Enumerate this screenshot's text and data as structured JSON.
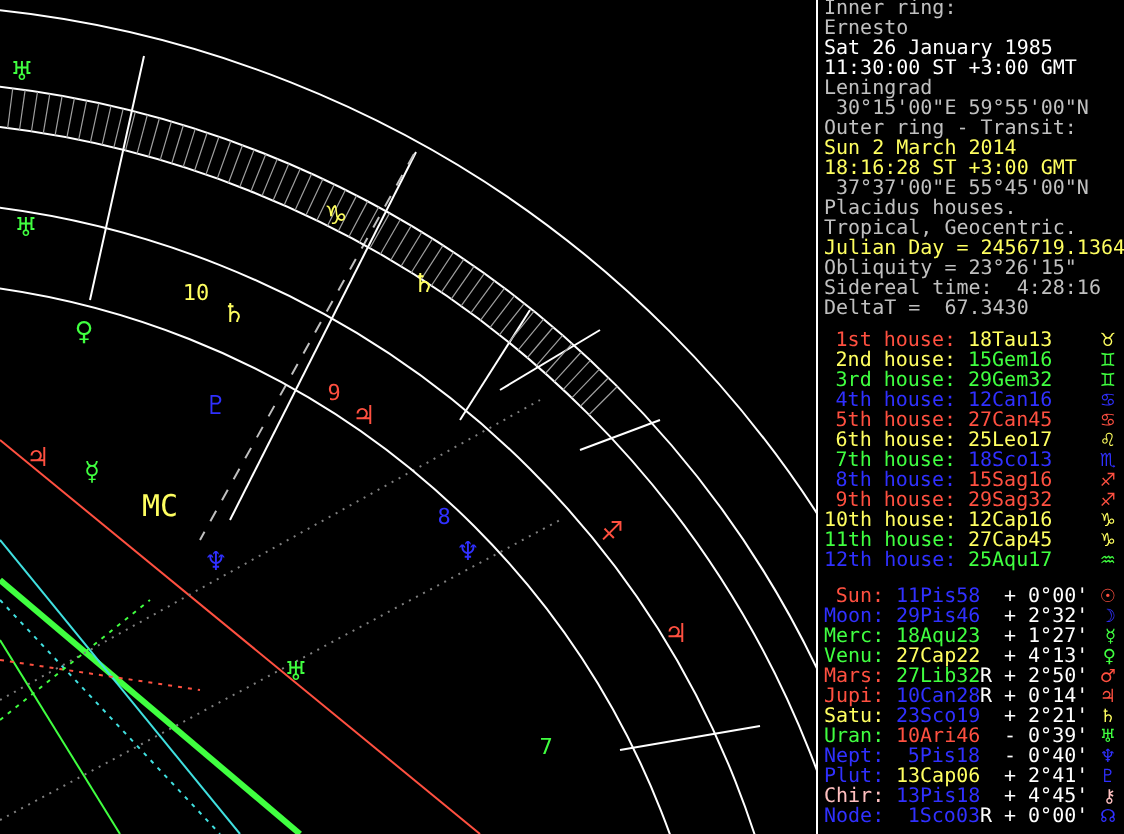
{
  "chart": {
    "labels": [
      {
        "kind": "planet",
        "text": "♅",
        "color": "#40ff40"
      },
      {
        "kind": "planet",
        "text": "♅",
        "color": "#40ff40"
      },
      {
        "kind": "sign",
        "text": "♑",
        "color": "#ffff60"
      },
      {
        "kind": "planet",
        "text": "♄",
        "color": "#ffff60"
      },
      {
        "kind": "house",
        "text": "10",
        "color": "#ffff60"
      },
      {
        "kind": "planet",
        "text": "♄",
        "color": "#ffff60"
      },
      {
        "kind": "planet",
        "text": "♀",
        "color": "#40ff40"
      },
      {
        "kind": "house",
        "text": "9",
        "color": "#ff5040"
      },
      {
        "kind": "planet",
        "text": "♇",
        "color": "#3030ff"
      },
      {
        "kind": "planet",
        "text": "♃",
        "color": "#ff5040"
      },
      {
        "kind": "planet",
        "text": "♃",
        "color": "#ff5040"
      },
      {
        "kind": "planet",
        "text": "☿",
        "color": "#40ff40"
      },
      {
        "kind": "angle",
        "text": "MC",
        "color": "#ffff60"
      },
      {
        "kind": "planet",
        "text": "♆",
        "color": "#3030ff"
      },
      {
        "kind": "house",
        "text": "8",
        "color": "#3030ff"
      },
      {
        "kind": "planet",
        "text": "♆",
        "color": "#3030ff"
      },
      {
        "kind": "sign",
        "text": "♐",
        "color": "#ff5040"
      },
      {
        "kind": "planet",
        "text": "♃",
        "color": "#ff5040"
      },
      {
        "kind": "planet",
        "text": "♅",
        "color": "#40ff40"
      },
      {
        "kind": "house",
        "text": "7",
        "color": "#40ff40"
      }
    ]
  },
  "info_lines": [
    {
      "text": "Inner ring:",
      "color": "#c0c0c0"
    },
    {
      "text": "Ernesto",
      "color": "#c0c0c0"
    },
    {
      "text": "Sat 26 January 1985",
      "color": "#ffffff"
    },
    {
      "text": "11:30:00 ST +3:00 GMT",
      "color": "#ffffff"
    },
    {
      "text": "Leningrad",
      "color": "#c0c0c0"
    },
    {
      "text": " 30°15'00\"E 59°55'00\"N",
      "color": "#c0c0c0"
    },
    {
      "text": "Outer ring - Transit:",
      "color": "#c0c0c0"
    },
    {
      "text": "Sun 2 March 2014",
      "color": "#ffff60"
    },
    {
      "text": "18:16:28 ST +3:00 GMT",
      "color": "#ffff60"
    },
    {
      "text": " 37°37'00\"E 55°45'00\"N",
      "color": "#c0c0c0"
    },
    {
      "text": "Placidus houses.",
      "color": "#c0c0c0"
    },
    {
      "text": "Tropical, Geocentric.",
      "color": "#c0c0c0"
    },
    {
      "text": "Julian Day = 2456719.1364",
      "color": "#ffff60"
    },
    {
      "text": "Obliquity = 23°26'15\"",
      "color": "#c0c0c0"
    },
    {
      "text": "Sidereal time:  4:28:16",
      "color": "#c0c0c0"
    },
    {
      "text": "DeltaT =  67.3430",
      "color": "#c0c0c0"
    }
  ],
  "houses": [
    {
      "label": "1st house:",
      "color": "#ff5040",
      "sign": {
        "position": "18Tau13",
        "glyph": "♉",
        "color": "#ffff60"
      }
    },
    {
      "label": "2nd house:",
      "color": "#ffff60",
      "sign": {
        "position": "15Gem16",
        "glyph": "♊",
        "color": "#40ff40"
      }
    },
    {
      "label": "3rd house:",
      "color": "#40ff40",
      "sign": {
        "position": "29Gem32",
        "glyph": "♊",
        "color": "#40ff40"
      }
    },
    {
      "label": "4th house:",
      "color": "#3030ff",
      "sign": {
        "position": "12Can16",
        "glyph": "♋",
        "color": "#3030ff"
      }
    },
    {
      "label": "5th house:",
      "color": "#ff5040",
      "sign": {
        "position": "27Can45",
        "glyph": "♋",
        "color": "#ff5040"
      }
    },
    {
      "label": "6th house:",
      "color": "#ffff60",
      "sign": {
        "position": "25Leo17",
        "glyph": "♌",
        "color": "#ffff60"
      }
    },
    {
      "label": "7th house:",
      "color": "#40ff40",
      "sign": {
        "position": "18Sco13",
        "glyph": "♏",
        "color": "#3030ff"
      }
    },
    {
      "label": "8th house:",
      "color": "#3030ff",
      "sign": {
        "position": "15Sag16",
        "glyph": "♐",
        "color": "#ff5040"
      }
    },
    {
      "label": "9th house:",
      "color": "#ff5040",
      "sign": {
        "position": "29Sag32",
        "glyph": "♐",
        "color": "#ff5040"
      }
    },
    {
      "label": "10th house:",
      "color": "#ffff60",
      "sign": {
        "position": "12Cap16",
        "glyph": "♑",
        "color": "#ffff60"
      }
    },
    {
      "label": "11th house:",
      "color": "#40ff40",
      "sign": {
        "position": "27Cap45",
        "glyph": "♑",
        "color": "#ffff60"
      }
    },
    {
      "label": "12th house:",
      "color": "#3030ff",
      "sign": {
        "position": "25Aqu17",
        "glyph": "♒",
        "color": "#40ff40"
      }
    }
  ],
  "planets": [
    {
      "name": "Sun:",
      "color": "#ff5040",
      "position": {
        "text": "11Pis58",
        "color": "#3030ff"
      },
      "offset": "+ 0°00'",
      "glyph": "☉"
    },
    {
      "name": "Moon:",
      "color": "#3030ff",
      "position": {
        "text": "29Pis46",
        "color": "#3030ff"
      },
      "offset": "+ 2°32'",
      "glyph": "☽"
    },
    {
      "name": "Merc:",
      "color": "#40ff40",
      "position": {
        "text": "18Aqu23",
        "color": "#40ff40"
      },
      "offset": "+ 1°27'",
      "glyph": "☿"
    },
    {
      "name": "Venu:",
      "color": "#40ff40",
      "position": {
        "text": "27Cap22",
        "color": "#ffff60"
      },
      "offset": "+ 4°13'",
      "glyph": "♀"
    },
    {
      "name": "Mars:",
      "color": "#ff5040",
      "position": {
        "text": "27Lib32",
        "color": "#40ff40"
      },
      "retrograde": "R",
      "offset": "+ 2°50'",
      "glyph": "♂"
    },
    {
      "name": "Jupi:",
      "color": "#ff5040",
      "position": {
        "text": "10Can28",
        "color": "#3030ff"
      },
      "retrograde": "R",
      "offset": "+ 0°14'",
      "glyph": "♃"
    },
    {
      "name": "Satu:",
      "color": "#ffff60",
      "position": {
        "text": "23Sco19",
        "color": "#3030ff"
      },
      "offset": "+ 2°21'",
      "glyph": "♄"
    },
    {
      "name": "Uran:",
      "color": "#40ff40",
      "position": {
        "text": "10Ari46",
        "color": "#ff5040"
      },
      "offset": "- 0°39'",
      "glyph": "♅"
    },
    {
      "name": "Nept:",
      "color": "#3030ff",
      "position": {
        "text": "5Pis18",
        "color": "#3030ff"
      },
      "offset": "- 0°40'",
      "glyph": "♆"
    },
    {
      "name": "Plut:",
      "color": "#3030ff",
      "position": {
        "text": "13Cap06",
        "color": "#ffff60"
      },
      "offset": "+ 2°41'",
      "glyph": "♇"
    },
    {
      "name": "Chir:",
      "color": "#ffc0c0",
      "position": {
        "text": "13Pis18",
        "color": "#3030ff"
      },
      "offset": "+ 4°45'",
      "glyph": "⚷"
    },
    {
      "name": "Node:",
      "color": "#3030ff",
      "position": {
        "text": "1Sco03",
        "color": "#3030ff"
      },
      "retrograde": "R",
      "offset": "+ 0°00'",
      "glyph": "☊"
    }
  ]
}
